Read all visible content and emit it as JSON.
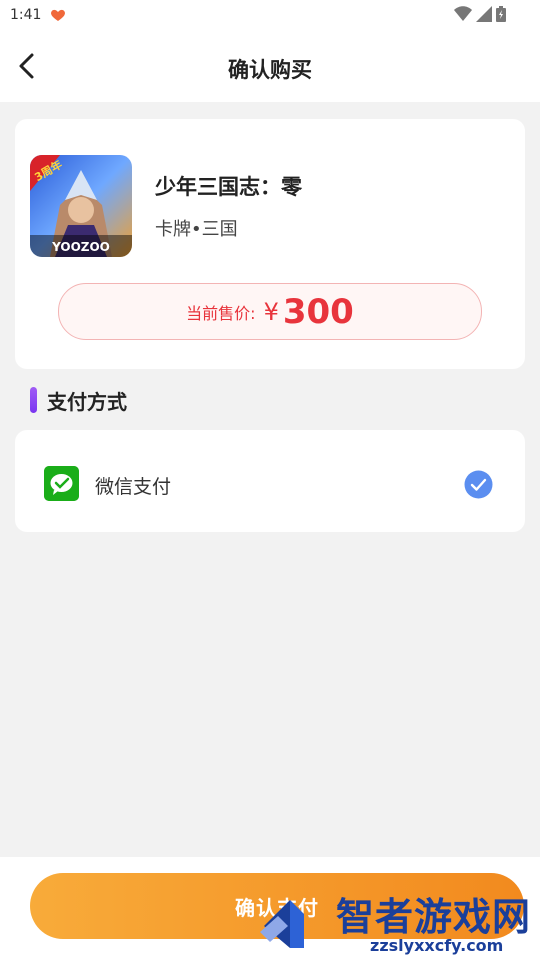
{
  "status": {
    "time": "1:41"
  },
  "nav": {
    "title": "确认购买"
  },
  "product": {
    "name": "少年三国志：零",
    "tags": "卡牌•三国",
    "icon_badge": "3周年",
    "icon_brand": "YOOZOO",
    "price_label": "当前售价:",
    "currency": "¥",
    "price": "300"
  },
  "payment": {
    "section_title": "支付方式",
    "method_label": "微信支付",
    "selected": true
  },
  "footer": {
    "confirm_label": "确认支付"
  },
  "watermark": {
    "brand": "智者游戏网",
    "url": "zzslyxxcfy.com"
  },
  "colors": {
    "accent": "#f8ab3a",
    "price": "#e8343c",
    "wechat": "#1aad19",
    "check": "#5b8ef0",
    "section_bar": "#8a44f2"
  }
}
